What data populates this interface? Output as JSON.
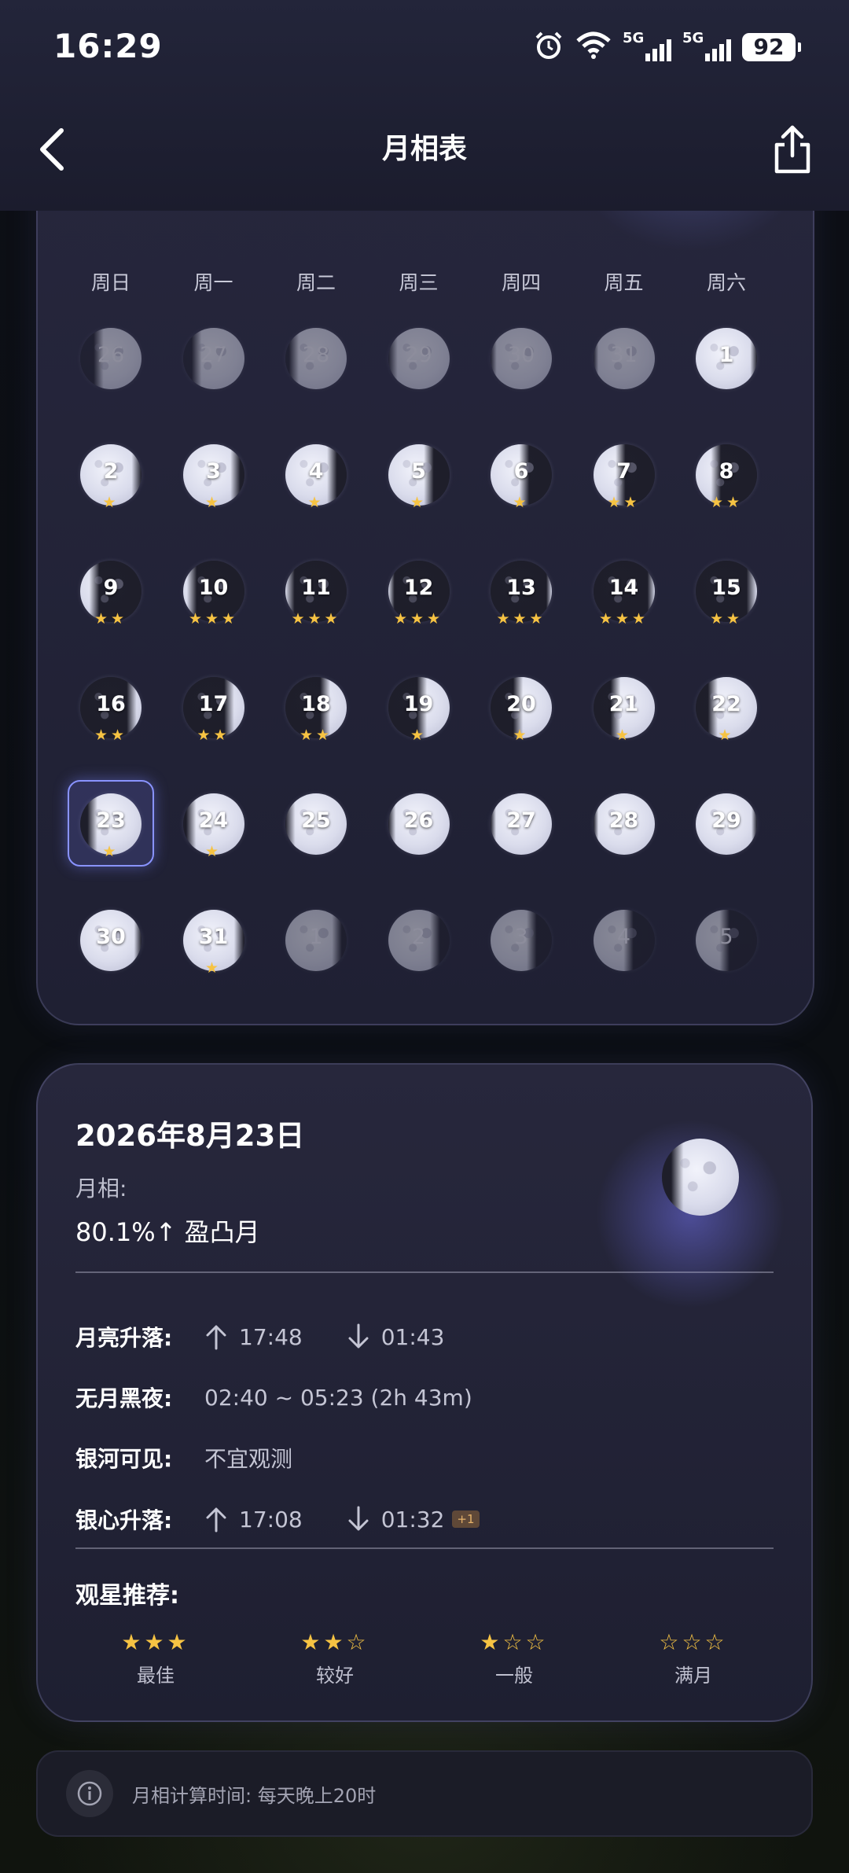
{
  "status_bar": {
    "time": "16:29",
    "network_1": "5G",
    "network_2": "5G",
    "battery": "92"
  },
  "header": {
    "title": "月相表",
    "back_icon": "chevron-left-icon",
    "share_icon": "share-icon"
  },
  "calendar": {
    "weekdays": [
      "周日",
      "周一",
      "周二",
      "周三",
      "周四",
      "周五",
      "周六"
    ],
    "days": [
      {
        "label": "26",
        "in_month": false,
        "stars": 0,
        "illum": 0.7,
        "waxing": true
      },
      {
        "label": "27",
        "in_month": false,
        "stars": 0,
        "illum": 0.78,
        "waxing": true
      },
      {
        "label": "28",
        "in_month": false,
        "stars": 0,
        "illum": 0.86,
        "waxing": true
      },
      {
        "label": "29",
        "in_month": false,
        "stars": 0,
        "illum": 0.93,
        "waxing": true
      },
      {
        "label": "30",
        "in_month": false,
        "stars": 0,
        "illum": 0.98,
        "waxing": true
      },
      {
        "label": "31",
        "in_month": false,
        "stars": 0,
        "illum": 1.0,
        "waxing": true
      },
      {
        "label": "1",
        "in_month": true,
        "stars": 0,
        "illum": 0.97,
        "waxing": false
      },
      {
        "label": "2",
        "in_month": true,
        "stars": 1,
        "illum": 0.92,
        "waxing": false
      },
      {
        "label": "3",
        "in_month": true,
        "stars": 1,
        "illum": 0.85,
        "waxing": false
      },
      {
        "label": "4",
        "in_month": true,
        "stars": 1,
        "illum": 0.76,
        "waxing": false
      },
      {
        "label": "5",
        "in_month": true,
        "stars": 1,
        "illum": 0.66,
        "waxing": false
      },
      {
        "label": "6",
        "in_month": true,
        "stars": 1,
        "illum": 0.55,
        "waxing": false
      },
      {
        "label": "7",
        "in_month": true,
        "stars": 2,
        "illum": 0.44,
        "waxing": false
      },
      {
        "label": "8",
        "in_month": true,
        "stars": 2,
        "illum": 0.33,
        "waxing": false
      },
      {
        "label": "9",
        "in_month": true,
        "stars": 2,
        "illum": 0.23,
        "waxing": false
      },
      {
        "label": "10",
        "in_month": true,
        "stars": 3,
        "illum": 0.14,
        "waxing": false
      },
      {
        "label": "11",
        "in_month": true,
        "stars": 3,
        "illum": 0.07,
        "waxing": false
      },
      {
        "label": "12",
        "in_month": true,
        "stars": 3,
        "illum": 0.02,
        "waxing": false
      },
      {
        "label": "13",
        "in_month": true,
        "stars": 3,
        "illum": 0.01,
        "waxing": true
      },
      {
        "label": "14",
        "in_month": true,
        "stars": 3,
        "illum": 0.04,
        "waxing": true
      },
      {
        "label": "15",
        "in_month": true,
        "stars": 2,
        "illum": 0.09,
        "waxing": true
      },
      {
        "label": "16",
        "in_month": true,
        "stars": 2,
        "illum": 0.16,
        "waxing": true
      },
      {
        "label": "17",
        "in_month": true,
        "stars": 2,
        "illum": 0.25,
        "waxing": true
      },
      {
        "label": "18",
        "in_month": true,
        "stars": 2,
        "illum": 0.35,
        "waxing": true
      },
      {
        "label": "19",
        "in_month": true,
        "stars": 1,
        "illum": 0.45,
        "waxing": true
      },
      {
        "label": "20",
        "in_month": true,
        "stars": 1,
        "illum": 0.55,
        "waxing": true
      },
      {
        "label": "21",
        "in_month": true,
        "stars": 1,
        "illum": 0.64,
        "waxing": true
      },
      {
        "label": "22",
        "in_month": true,
        "stars": 1,
        "illum": 0.72,
        "waxing": true
      },
      {
        "label": "23",
        "in_month": true,
        "stars": 1,
        "illum": 0.8,
        "waxing": true,
        "selected": true
      },
      {
        "label": "24",
        "in_month": true,
        "stars": 1,
        "illum": 0.87,
        "waxing": true
      },
      {
        "label": "25",
        "in_month": true,
        "stars": 0,
        "illum": 0.92,
        "waxing": true
      },
      {
        "label": "26",
        "in_month": true,
        "stars": 0,
        "illum": 0.96,
        "waxing": true
      },
      {
        "label": "27",
        "in_month": true,
        "stars": 0,
        "illum": 0.99,
        "waxing": true
      },
      {
        "label": "28",
        "in_month": true,
        "stars": 0,
        "illum": 1.0,
        "waxing": true
      },
      {
        "label": "29",
        "in_month": true,
        "stars": 0,
        "illum": 0.99,
        "waxing": false
      },
      {
        "label": "30",
        "in_month": true,
        "stars": 0,
        "illum": 0.96,
        "waxing": false
      },
      {
        "label": "31",
        "in_month": true,
        "stars": 1,
        "illum": 0.91,
        "waxing": false
      },
      {
        "label": "1",
        "in_month": false,
        "stars": 0,
        "illum": 0.84,
        "waxing": false
      },
      {
        "label": "2",
        "in_month": false,
        "stars": 0,
        "illum": 0.76,
        "waxing": false
      },
      {
        "label": "3",
        "in_month": false,
        "stars": 0,
        "illum": 0.67,
        "waxing": false
      },
      {
        "label": "4",
        "in_month": false,
        "stars": 0,
        "illum": 0.57,
        "waxing": false
      },
      {
        "label": "5",
        "in_month": false,
        "stars": 0,
        "illum": 0.47,
        "waxing": false
      }
    ]
  },
  "detail": {
    "date": "2026年8月23日",
    "phase_label": "月相:",
    "phase_value": "80.1%↑ 盈凸月",
    "moonrise_label": "月亮升落:",
    "moonrise": "17:48",
    "moonset": "01:43",
    "dark_label": "无月黑夜:",
    "dark_value": "02:40 ~ 05:23 (2h 43m)",
    "milkyway_label": "银河可见:",
    "milkyway_value": "不宜观测",
    "core_label": "银心升落:",
    "core_rise": "17:08",
    "core_set": "01:32",
    "core_badge": "+1",
    "recommend_title": "观星推荐:",
    "legend": [
      {
        "filled": 3,
        "label": "最佳"
      },
      {
        "filled": 2,
        "label": "较好"
      },
      {
        "filled": 1,
        "label": "一般"
      },
      {
        "filled": 0,
        "label": "满月"
      }
    ]
  },
  "note": {
    "text": "月相计算时间: 每天晚上20时",
    "icon": "info-icon"
  },
  "colors": {
    "star": "#f6c343",
    "selected_border": "#8993ff"
  }
}
